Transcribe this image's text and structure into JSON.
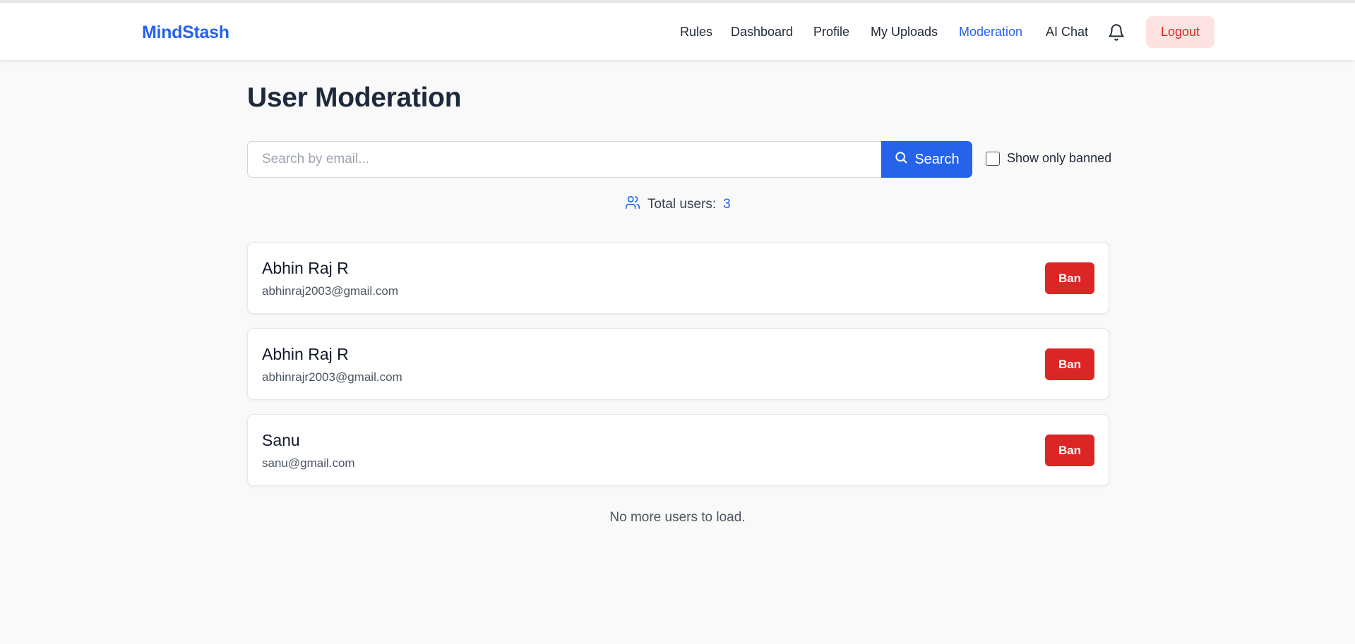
{
  "header": {
    "brand": "MindStash",
    "nav": [
      {
        "label": "Rules",
        "active": false
      },
      {
        "label": "Dashboard",
        "active": false
      },
      {
        "label": "Profile",
        "active": false
      },
      {
        "label": "My Uploads",
        "active": false
      },
      {
        "label": "Moderation",
        "active": true
      },
      {
        "label": "AI Chat",
        "active": false
      }
    ],
    "notification_icon": "bell-icon",
    "logout_label": "Logout"
  },
  "main": {
    "title": "User Moderation",
    "search": {
      "placeholder": "Search by email...",
      "value": "",
      "button_label": "Search",
      "button_icon": "search-icon"
    },
    "filter": {
      "label": "Show only banned",
      "checked": false
    },
    "total": {
      "icon": "users-icon",
      "label": "Total users:",
      "count": "3"
    },
    "users": [
      {
        "name": "Abhin Raj R",
        "email": "abhinraj2003@gmail.com",
        "action": "Ban"
      },
      {
        "name": "Abhin Raj R",
        "email": "abhinrajr2003@gmail.com",
        "action": "Ban"
      },
      {
        "name": "Sanu",
        "email": "sanu@gmail.com",
        "action": "Ban"
      }
    ],
    "footer_message": "No more users to load."
  },
  "colors": {
    "accent": "#2563eb",
    "danger": "#dc2626",
    "logout_bg": "#fde2e2",
    "page_bg": "#f9f9f9"
  }
}
